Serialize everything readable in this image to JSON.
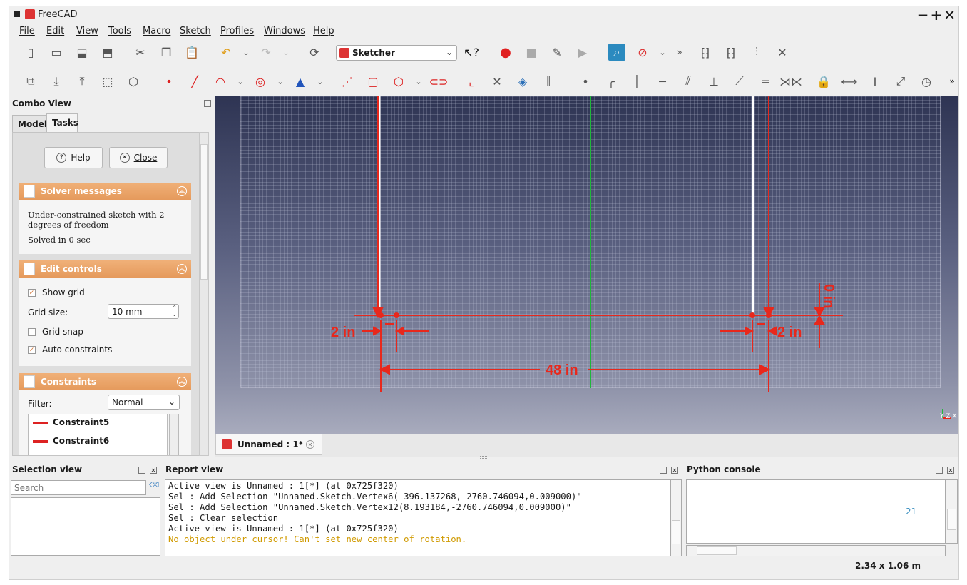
{
  "window": {
    "title": "FreeCAD",
    "controls": "−+✕"
  },
  "menu": [
    "File",
    "Edit",
    "View",
    "Tools",
    "Macro",
    "Sketch",
    "Profiles",
    "Windows",
    "Help"
  ],
  "workbench": {
    "selected": "Sketcher"
  },
  "toolbar1_icons": [
    "new-document-icon",
    "open-icon",
    "save-icon",
    "save-as-icon",
    "cut-icon",
    "copy-icon",
    "paste-icon",
    "undo-icon",
    "redo-icon",
    "refresh-icon",
    "whats-this-icon",
    "record-macro-icon",
    "stop-macro-icon",
    "edit-macro-icon",
    "run-macro-icon",
    "zoom-icon",
    "draw-style-icon",
    "more-icon"
  ],
  "combo": {
    "title": "Combo View",
    "tabs": [
      "Model",
      "Tasks"
    ],
    "active_tab": "Tasks",
    "help_label": "Help",
    "close_label": "Close",
    "solver": {
      "title": "Solver messages",
      "message": "Under-constrained sketch with 2 degrees of freedom",
      "solved": "Solved in 0 sec"
    },
    "edit_controls": {
      "title": "Edit controls",
      "show_grid": "Show grid",
      "show_grid_checked": true,
      "grid_size_label": "Grid size:",
      "grid_size_value": "10 mm",
      "grid_snap": "Grid snap",
      "grid_snap_checked": false,
      "auto_constraints": "Auto constraints",
      "auto_constraints_checked": true
    },
    "constraints": {
      "title": "Constraints",
      "filter_label": "Filter:",
      "filter_value": "Normal",
      "items": [
        "Constraint5",
        "Constraint6"
      ]
    }
  },
  "sketch": {
    "dim_left": "2 in",
    "dim_right": "2 in",
    "dim_width": "48 in",
    "dim_vertical": "0 in",
    "axis_label": "Y Z X",
    "colors": {
      "constraint": "#e8281c",
      "axis": "#1fb83a",
      "geometry": "#ffffff"
    }
  },
  "document_tab": {
    "label": "Unnamed : 1*"
  },
  "selection_view": {
    "title": "Selection view",
    "search_placeholder": "Search"
  },
  "report_view": {
    "title": "Report view",
    "lines": [
      "Active view is Unnamed : 1[*] (at 0x725f320)",
      "Sel : Add Selection \"Unnamed.Sketch.Vertex6(-396.137268,-2760.746094,0.009000)\"",
      "Sel : Add Selection \"Unnamed.Sketch.Vertex12(8.193184,-2760.746094,0.009000)\"",
      "Sel : Clear selection",
      "Active view is Unnamed : 1[*] (at 0x725f320)"
    ],
    "warning": "No object under cursor! Can't set new center of rotation."
  },
  "python_console": {
    "title": "Python console",
    "line_number": "21"
  },
  "status": {
    "dimensions": "2.34 x 1.06 m"
  }
}
